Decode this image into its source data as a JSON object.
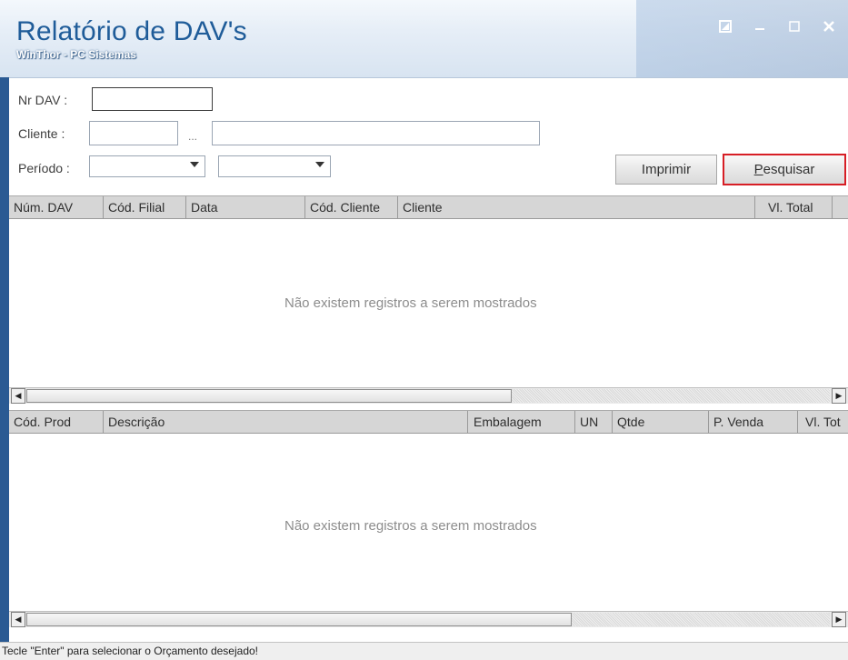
{
  "window": {
    "title": "Relatório de DAV's",
    "subtitle": "WinThor - PC Sistemas",
    "controls": [
      "restore-icon",
      "minimize-icon",
      "maximize-icon",
      "close-icon"
    ]
  },
  "filters": {
    "nr_dav_label": "Nr DAV :",
    "nr_dav_value": "",
    "cliente_label": "Cliente :",
    "cliente_code_value": "",
    "cliente_lookup": "...",
    "cliente_name_value": "",
    "periodo_label": "Período :",
    "periodo_start_value": "",
    "periodo_end_value": ""
  },
  "buttons": {
    "imprimir": "Imprimir",
    "pesquisar_hotkey": "P",
    "pesquisar_rest": "esquisar",
    "highlight_color": "#d71e25"
  },
  "grid_top": {
    "columns": [
      "Núm. DAV",
      "Cód. Filial",
      "Data",
      "Cód. Cliente",
      "Cliente",
      "Vl. Total"
    ],
    "empty_message": "Não existem registros a serem mostrados"
  },
  "grid_bottom": {
    "columns": [
      "Cód. Prod",
      "Descrição",
      "Embalagem",
      "UN",
      "Qtde",
      "P. Venda",
      "Vl. Tot"
    ],
    "empty_message": "Não existem registros a serem mostrados"
  },
  "status_bar": {
    "text": "Tecle \"Enter\" para selecionar o Orçamento desejado!"
  },
  "colors": {
    "title": "#1f5c99",
    "frame": "#2a5a93"
  }
}
